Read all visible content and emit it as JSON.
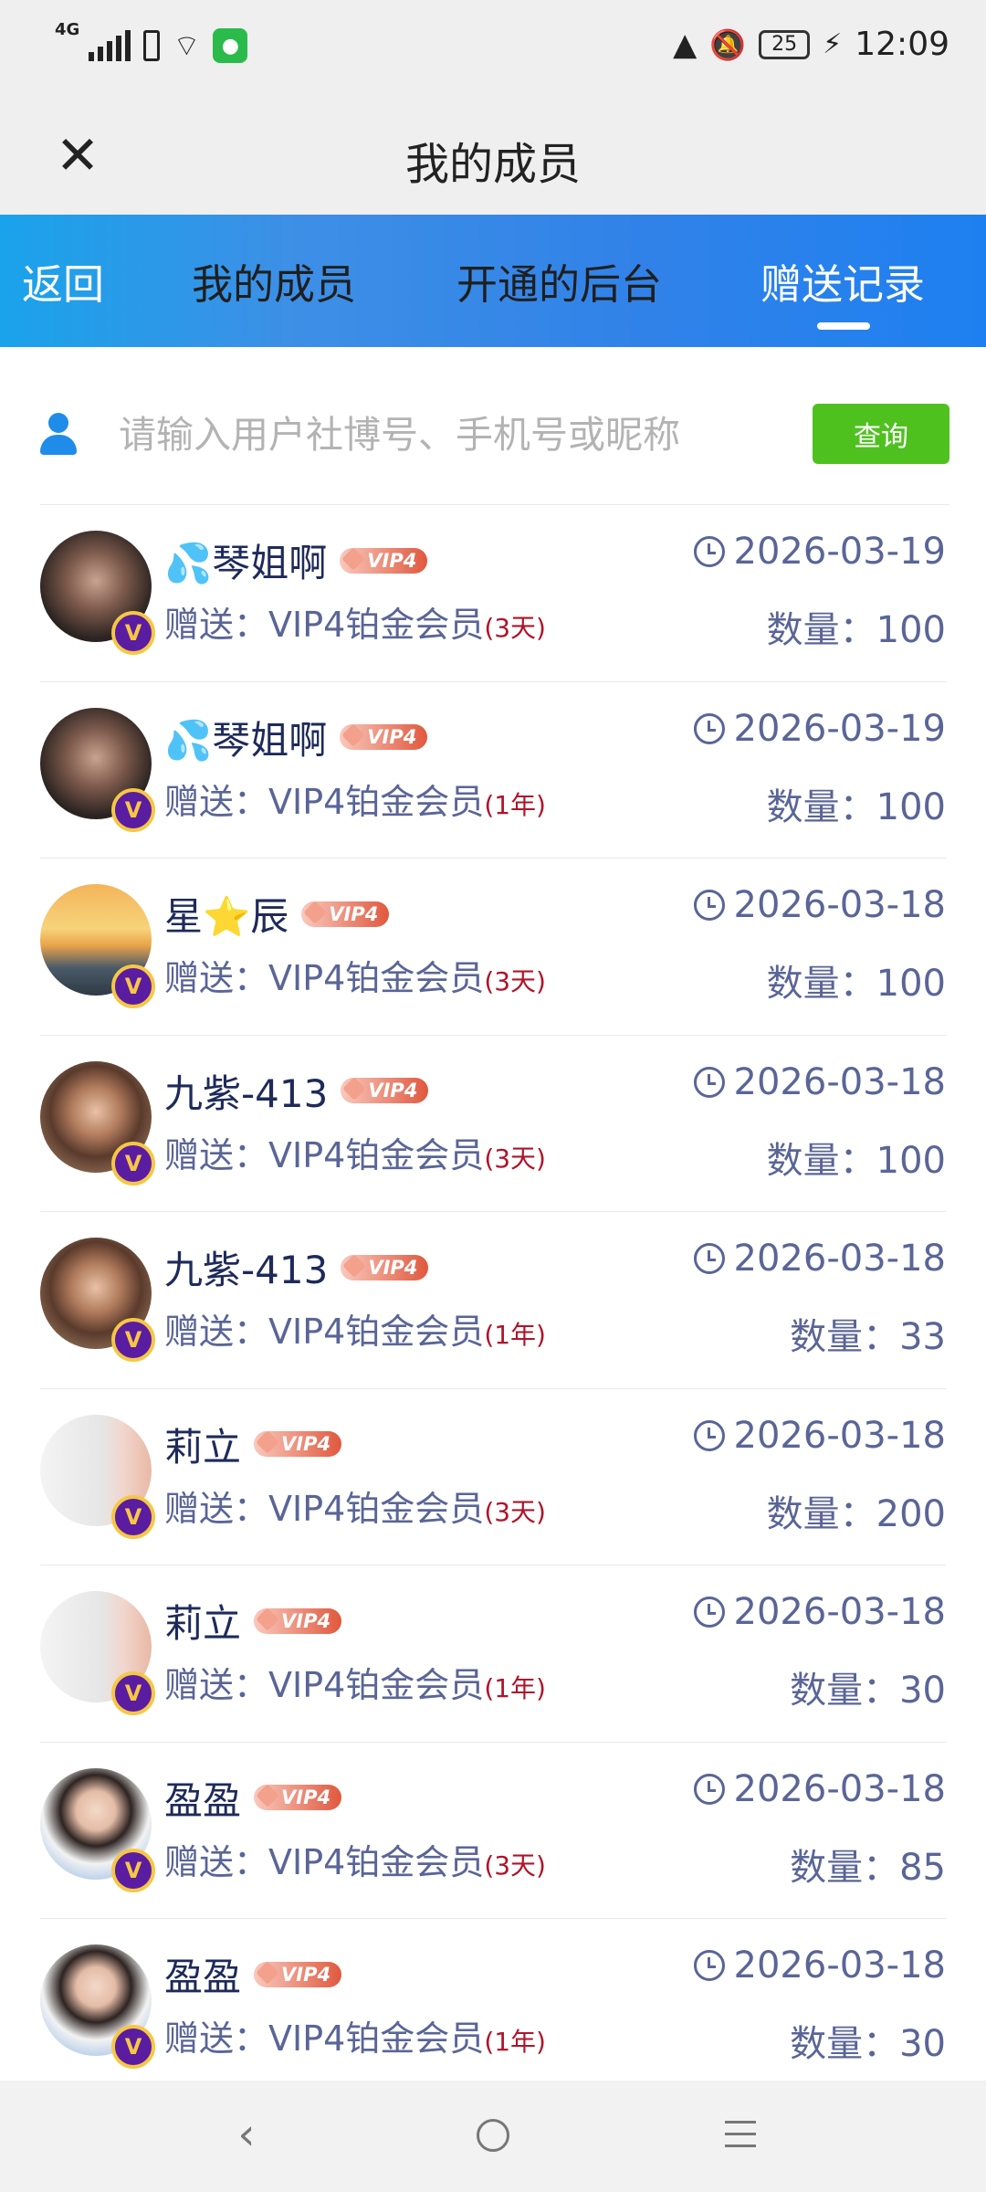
{
  "status_bar": {
    "network": "4G",
    "battery": "25",
    "time": "12:09"
  },
  "header": {
    "title": "我的成员"
  },
  "tabs": {
    "back": "返回",
    "items": [
      "我的成员",
      "开通的后台",
      "赠送记录"
    ],
    "active_index": 2
  },
  "search": {
    "placeholder": "请输入用户社博号、手机号或昵称",
    "value": "",
    "button": "查询"
  },
  "records": [
    {
      "name": "💦琴姐啊",
      "vip": "VIP4",
      "gift_prefix": "赠送：",
      "gift": "VIP4铂金会员",
      "duration": "(3天)",
      "date": "2026-03-19",
      "qty_label": "数量：",
      "qty": "100"
    },
    {
      "name": "💦琴姐啊",
      "vip": "VIP4",
      "gift_prefix": "赠送：",
      "gift": "VIP4铂金会员",
      "duration": "(1年)",
      "date": "2026-03-19",
      "qty_label": "数量：",
      "qty": "100"
    },
    {
      "name": "星⭐辰",
      "vip": "VIP4",
      "gift_prefix": "赠送：",
      "gift": "VIP4铂金会员",
      "duration": "(3天)",
      "date": "2026-03-18",
      "qty_label": "数量：",
      "qty": "100"
    },
    {
      "name": "九紫-413",
      "vip": "VIP4",
      "gift_prefix": "赠送：",
      "gift": "VIP4铂金会员",
      "duration": "(3天)",
      "date": "2026-03-18",
      "qty_label": "数量：",
      "qty": "100"
    },
    {
      "name": "九紫-413",
      "vip": "VIP4",
      "gift_prefix": "赠送：",
      "gift": "VIP4铂金会员",
      "duration": "(1年)",
      "date": "2026-03-18",
      "qty_label": "数量：",
      "qty": "33"
    },
    {
      "name": "莉立",
      "vip": "VIP4",
      "gift_prefix": "赠送：",
      "gift": "VIP4铂金会员",
      "duration": "(3天)",
      "date": "2026-03-18",
      "qty_label": "数量：",
      "qty": "200"
    },
    {
      "name": "莉立",
      "vip": "VIP4",
      "gift_prefix": "赠送：",
      "gift": "VIP4铂金会员",
      "duration": "(1年)",
      "date": "2026-03-18",
      "qty_label": "数量：",
      "qty": "30"
    },
    {
      "name": "盈盈",
      "vip": "VIP4",
      "gift_prefix": "赠送：",
      "gift": "VIP4铂金会员",
      "duration": "(3天)",
      "date": "2026-03-18",
      "qty_label": "数量：",
      "qty": "85"
    },
    {
      "name": "盈盈",
      "vip": "VIP4",
      "gift_prefix": "赠送：",
      "gift": "VIP4铂金会员",
      "duration": "(1年)",
      "date": "2026-03-18",
      "qty_label": "数量：",
      "qty": "30"
    }
  ],
  "colors": {
    "tab_gradient_start": "#1aa3ea",
    "tab_gradient_end": "#1e80f0",
    "query_button": "#4fc11f",
    "name_text": "#1e2a5a",
    "secondary_text": "#5a6597",
    "duration_text": "#b0142a"
  }
}
